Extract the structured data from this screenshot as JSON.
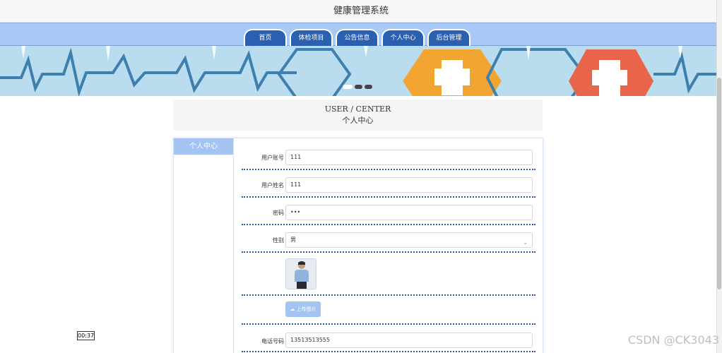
{
  "header": {
    "title": "健康管理系统"
  },
  "nav": {
    "tabs": [
      {
        "label": "首页"
      },
      {
        "label": "体检项目"
      },
      {
        "label": "公告信息"
      },
      {
        "label": "个人中心"
      },
      {
        "label": "后台管理"
      }
    ]
  },
  "user_center": {
    "title_en": "USER / CENTER",
    "title_cn": "个人中心"
  },
  "sidebar": {
    "items": [
      {
        "label": "个人中心"
      }
    ]
  },
  "form": {
    "account": {
      "label": "用户账号",
      "value": "111"
    },
    "name": {
      "label": "用户姓名",
      "value": "111"
    },
    "password": {
      "label": "密码",
      "value": "•••"
    },
    "gender": {
      "label": "性别",
      "value": "男"
    },
    "upload_label": "上传图片",
    "phone": {
      "label": "电话号码",
      "value": "13513513555"
    }
  },
  "overlay": {
    "timer": "00:37",
    "watermark": "CSDN @CK3043"
  },
  "colors": {
    "nav_bar": "#a8c8f5",
    "nav_tab": "#2b5fb0",
    "accent": "#a3c3f3",
    "divider": "#2a5aa5"
  },
  "icons": {
    "upload": "cloud-upload-icon",
    "select": "chevron-down-icon"
  }
}
